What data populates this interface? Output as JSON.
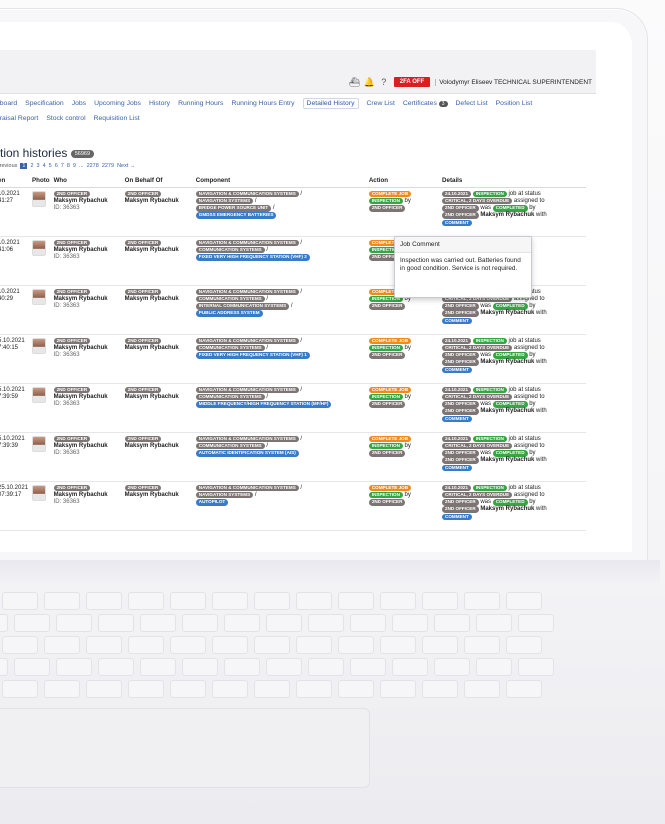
{
  "topbar": {
    "twofa_label": "2FA OFF",
    "user_label": "Volodymyr Eliseev  TECHNICAL SUPERINTENDENT"
  },
  "nav": {
    "row1": [
      "hboard",
      "Specification",
      "Jobs",
      "Upcoming Jobs",
      "History",
      "Running Hours",
      "Running Hours Entry",
      "Detailed History",
      "Crew List",
      "Certificates",
      "Defect List",
      "Position List"
    ],
    "certificates_badge": "3",
    "row2": [
      "praisal Report",
      "Stock control",
      "Requisition List"
    ]
  },
  "page": {
    "title": "tion histories",
    "count": "56969"
  },
  "pager": {
    "prev": "Previous",
    "pages": [
      "1",
      "2",
      "3",
      "4",
      "5",
      "6",
      "7",
      "8",
      "9",
      "...",
      "2278",
      "2279"
    ],
    "next": "Next →"
  },
  "table": {
    "headers": [
      "en",
      "Photo",
      "Who",
      "On Behalf Of",
      "Component",
      "Action",
      "Details"
    ],
    "rows": [
      {
        "date": "10.2021",
        "time": "41:27",
        "role": "2ND OFFICER",
        "name": "Maksym Rybachuk",
        "id": "ID: 36363",
        "behalf_role": "2ND OFFICER",
        "behalf_name": "Maksym Rybachuk",
        "components": [
          [
            "NAVIGATION & COMMUNICATION SYSTEMS",
            "/"
          ],
          [
            "NAVIGATION SYSTEMS",
            "/"
          ],
          [
            "BRIDGE POWER SOURCE UNIT",
            "/"
          ],
          [
            "GMDSS EMERGENCY BATTERIES",
            ""
          ]
        ],
        "d_date": "24.10.2021",
        "d_type": "INSPECTION",
        "d_text1": "job at status",
        "d_crit": "critical, 2 days overdue",
        "d_text2": "assigned to",
        "d_role": "2ND OFFICER",
        "d_was": "was",
        "d_status": "completed",
        "d_by": "by",
        "d_role2": "2ND OFFICER",
        "d_name": "Maksym Rybachuk",
        "d_with": "with",
        "d_comment": "comment"
      },
      {
        "date": "10.2021",
        "time": "41:06",
        "role": "2ND OFFICER",
        "name": "Maksym Rybachuk",
        "id": "ID: 36363",
        "behalf_role": "2ND OFFICER",
        "behalf_name": "Maksym Rybachuk",
        "components": [
          [
            "NAVIGATION & COMMUNICATION SYSTEMS",
            "/"
          ],
          [
            "COMMUNICATION SYSTEMS",
            "/"
          ],
          [
            "FIXED VERY HIGH FREQUENCY STATION (VHF) 2",
            ""
          ]
        ],
        "d_date": "",
        "d_type": "",
        "d_text1": "job at status",
        "d_crit": "",
        "d_text2": "signed to",
        "d_role": "",
        "d_was": "",
        "d_status": "",
        "d_by": "by",
        "d_role2": "",
        "d_name": "chuk with",
        "d_with": "",
        "d_comment": ""
      },
      {
        "date": "10.2021",
        "time": "40:29",
        "role": "2ND OFFICER",
        "name": "Maksym Rybachuk",
        "id": "ID: 36363",
        "behalf_role": "2ND OFFICER",
        "behalf_name": "Maksym Rybachuk",
        "components": [
          [
            "NAVIGATION & COMMUNICATION SYSTEMS",
            "/"
          ],
          [
            "COMMUNICATION SYSTEMS",
            "/"
          ],
          [
            "INTERNAL COMMUNICATION SYSTEMS",
            "/"
          ],
          [
            "PUBLIC ADDRESS SYSTEM",
            ""
          ]
        ],
        "d_date": "24.10.2021",
        "d_type": "INSPECTION",
        "d_text1": "job at status",
        "d_crit": "critical, 2 days overdue",
        "d_text2": "assigned to",
        "d_role": "2ND OFFICER",
        "d_was": "was",
        "d_status": "completed",
        "d_by": "by",
        "d_role2": "2ND OFFICER",
        "d_name": "Maksym Rybachuk",
        "d_with": "with",
        "d_comment": "comment"
      },
      {
        "date": "5.10.2021",
        "time": "7:40:15",
        "role": "2ND OFFICER",
        "name": "Maksym Rybachuk",
        "id": "ID: 36363",
        "behalf_role": "2ND OFFICER",
        "behalf_name": "Maksym Rybachuk",
        "components": [
          [
            "NAVIGATION & COMMUNICATION SYSTEMS",
            "/"
          ],
          [
            "COMMUNICATION SYSTEMS",
            "/"
          ],
          [
            "FIXED VERY HIGH FREQUENCY STATION (VHF) 1",
            ""
          ]
        ],
        "d_date": "24.10.2021",
        "d_type": "INSPECTION",
        "d_text1": "job at status",
        "d_crit": "critical, 2 days overdue",
        "d_text2": "assigned to",
        "d_role": "2ND OFFICER",
        "d_was": "was",
        "d_status": "completed",
        "d_by": "by",
        "d_role2": "2ND OFFICER",
        "d_name": "Maksym Rybachuk",
        "d_with": "with",
        "d_comment": "comment"
      },
      {
        "date": "5.10.2021",
        "time": "7:39:59",
        "role": "2ND OFFICER",
        "name": "Maksym Rybachuk",
        "id": "ID: 36363",
        "behalf_role": "2ND OFFICER",
        "behalf_name": "Maksym Rybachuk",
        "components": [
          [
            "NAVIGATION & COMMUNICATION SYSTEMS",
            "/"
          ],
          [
            "COMMUNICATION SYSTEMS",
            "/"
          ],
          [
            "MIDDLE FREQUENCY/HIGH FREQUENCY STATION (MF/HF)",
            ""
          ]
        ],
        "d_date": "24.10.2021",
        "d_type": "INSPECTION",
        "d_text1": "job at status",
        "d_crit": "critical, 2 days overdue",
        "d_text2": "assigned to",
        "d_role": "2ND OFFICER",
        "d_was": "was",
        "d_status": "completed",
        "d_by": "by",
        "d_role2": "2ND OFFICER",
        "d_name": "Maksym Rybachuk",
        "d_with": "with",
        "d_comment": "comment"
      },
      {
        "date": "5.10.2021",
        "time": "7:39:39",
        "role": "2ND OFFICER",
        "name": "Maksym Rybachuk",
        "id": "ID: 36363",
        "behalf_role": "2ND OFFICER",
        "behalf_name": "Maksym Rybachuk",
        "components": [
          [
            "NAVIGATION & COMMUNICATION SYSTEMS",
            "/"
          ],
          [
            "COMMUNICATION SYSTEMS",
            "/"
          ],
          [
            "AUTOMATIC IDENTIFICATION SYSTEM (AIS)",
            ""
          ]
        ],
        "d_date": "24.10.2021",
        "d_type": "INSPECTION",
        "d_text1": "job at status",
        "d_crit": "critical, 2 days overdue",
        "d_text2": "assigned to",
        "d_role": "2ND OFFICER",
        "d_was": "was",
        "d_status": "completed",
        "d_by": "by",
        "d_role2": "2ND OFFICER",
        "d_name": "Maksym Rybachuk",
        "d_with": "with",
        "d_comment": "comment"
      },
      {
        "date": "25.10.2021",
        "time": "07:39:17",
        "role": "2ND OFFICER",
        "name": "Maksym Rybachuk",
        "id": "ID: 36363",
        "behalf_role": "2ND OFFICER",
        "behalf_name": "Maksym Rybachuk",
        "components": [
          [
            "NAVIGATION & COMMUNICATION SYSTEMS",
            "/"
          ],
          [
            "NAVIGATION SYSTEMS",
            "/"
          ],
          [
            "AUTOPILOT",
            ""
          ]
        ],
        "d_date": "24.10.2021",
        "d_type": "INSPECTION",
        "d_text1": "job at status",
        "d_crit": "critical, 2 days overdue",
        "d_text2": "assigned to",
        "d_role": "2ND OFFICER",
        "d_was": "was",
        "d_status": "completed",
        "d_by": "by",
        "d_role2": "2ND OFFICER",
        "d_name": "Maksym Rybachuk",
        "d_with": "with",
        "d_comment": "comment"
      }
    ],
    "action_label": "Complete Job",
    "action_type": "INSPECTION",
    "action_by": "by",
    "action_role": "2ND OFFICER"
  },
  "tooltip": {
    "title": "Job Comment",
    "body": "Inspection was carried out. Batteries found in good condition. Service is not required."
  },
  "colors": {
    "accent": "#3a62a8",
    "danger": "#d91f1f",
    "success": "#35a642",
    "warning": "#f08a1d"
  }
}
